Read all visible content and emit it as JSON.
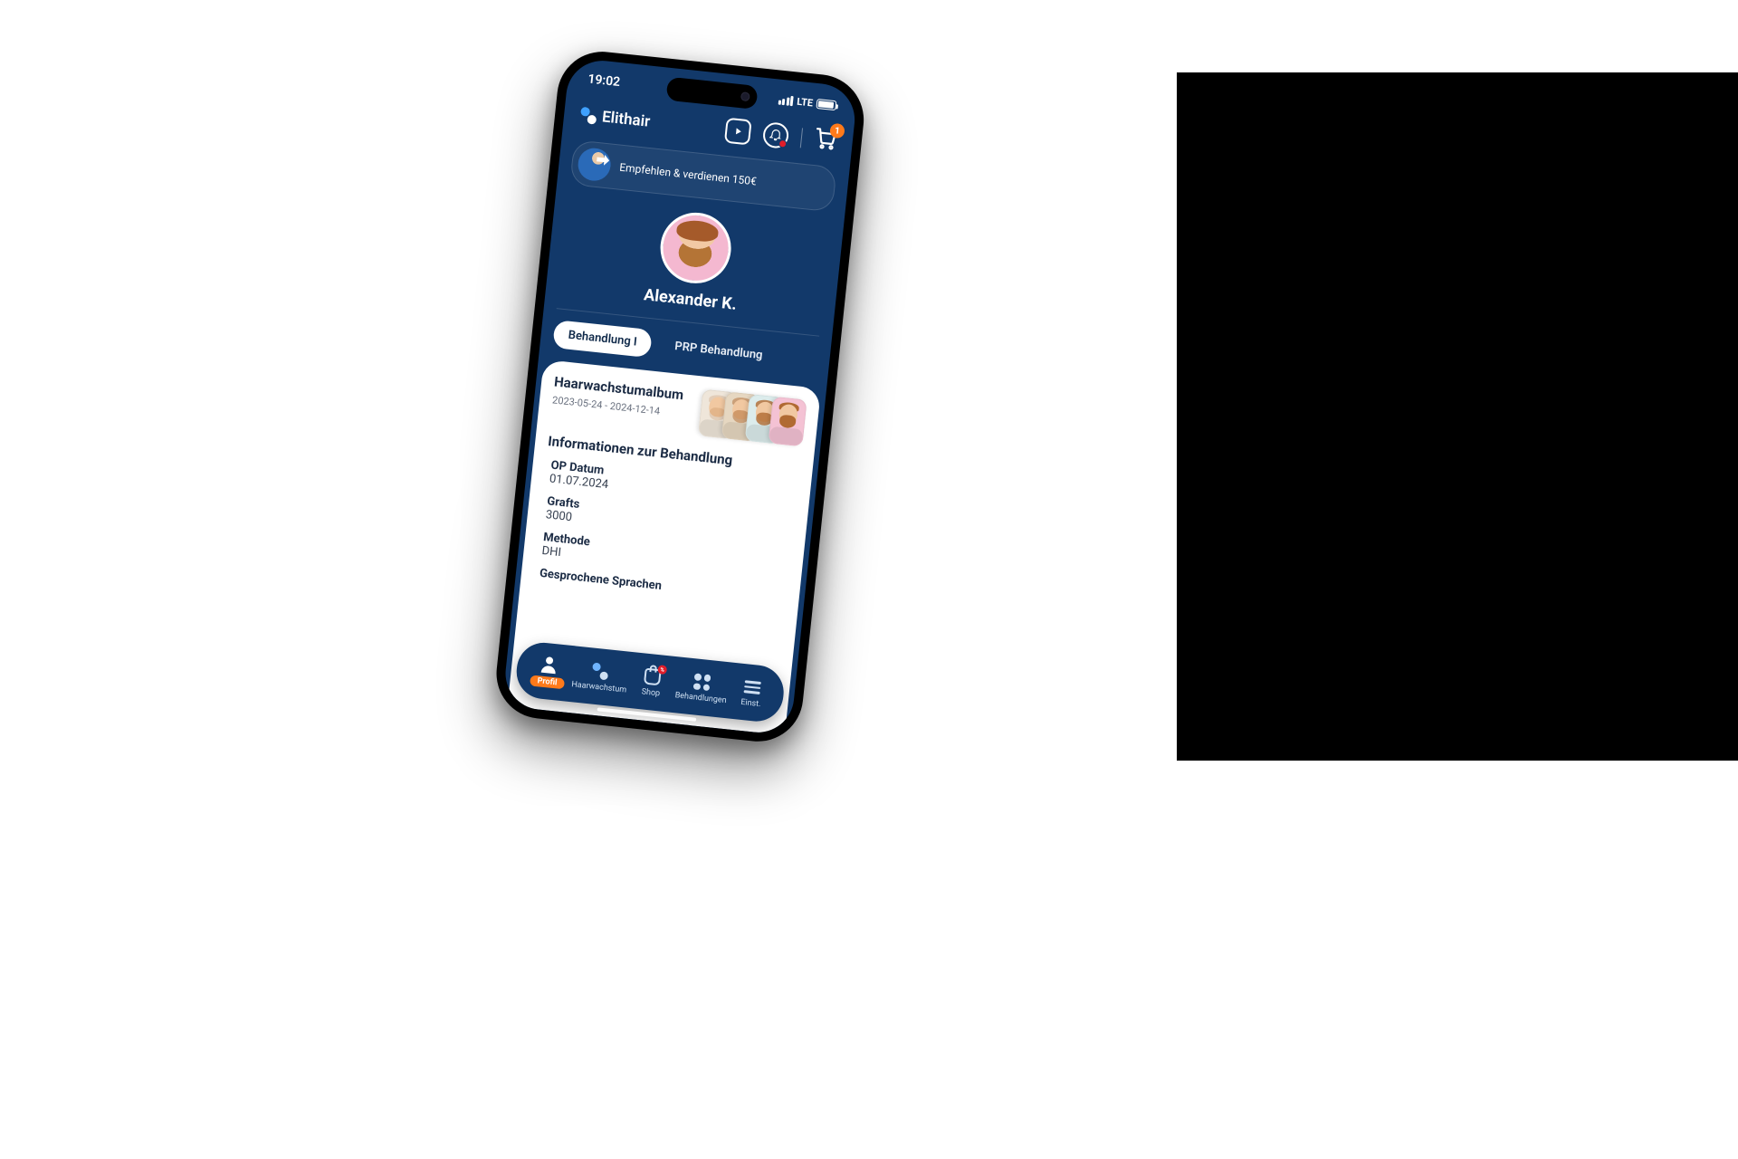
{
  "status": {
    "time": "19:02",
    "network": "LTE"
  },
  "brand": "Elithair",
  "cart": {
    "count": "1"
  },
  "referral": {
    "text": "Empfehlen & verdienen 150€"
  },
  "user": {
    "name": "Alexander K."
  },
  "tabs": {
    "treatment1": "Behandlung I",
    "prp": "PRP Behandlung"
  },
  "album": {
    "title": "Haarwachstumalbum",
    "dates": "2023-05-24 - 2024-12-14"
  },
  "info": {
    "heading": "Informationen zur Behandlung",
    "op_date_label": "OP Datum",
    "op_date_value": "01.07.2024",
    "grafts_label": "Grafts",
    "grafts_value": "3000",
    "method_label": "Methode",
    "method_value": "DHI",
    "languages_label": "Gesprochene Sprachen"
  },
  "nav": {
    "profile": "Profil",
    "growth": "Haarwachstum",
    "shop": "Shop",
    "shop_badge": "%",
    "treatments": "Behandlungen",
    "settings": "Einst."
  }
}
